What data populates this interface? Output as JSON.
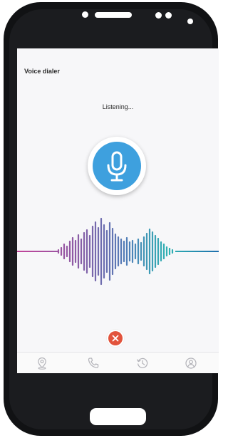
{
  "app": {
    "title": "Voice dialer",
    "status": "Listening..."
  },
  "mic_button": {
    "icon": "microphone-icon",
    "color": "#3ea0de"
  },
  "cancel_button": {
    "icon": "close-icon",
    "color": "#e2533c"
  },
  "waveform": {
    "left_color": "#c2449a",
    "right_color": "#1f6fae"
  },
  "nav": {
    "items": [
      {
        "name": "location",
        "icon": "location-pin-icon"
      },
      {
        "name": "phone",
        "icon": "phone-icon"
      },
      {
        "name": "history",
        "icon": "history-icon"
      },
      {
        "name": "profile",
        "icon": "user-icon"
      }
    ]
  }
}
